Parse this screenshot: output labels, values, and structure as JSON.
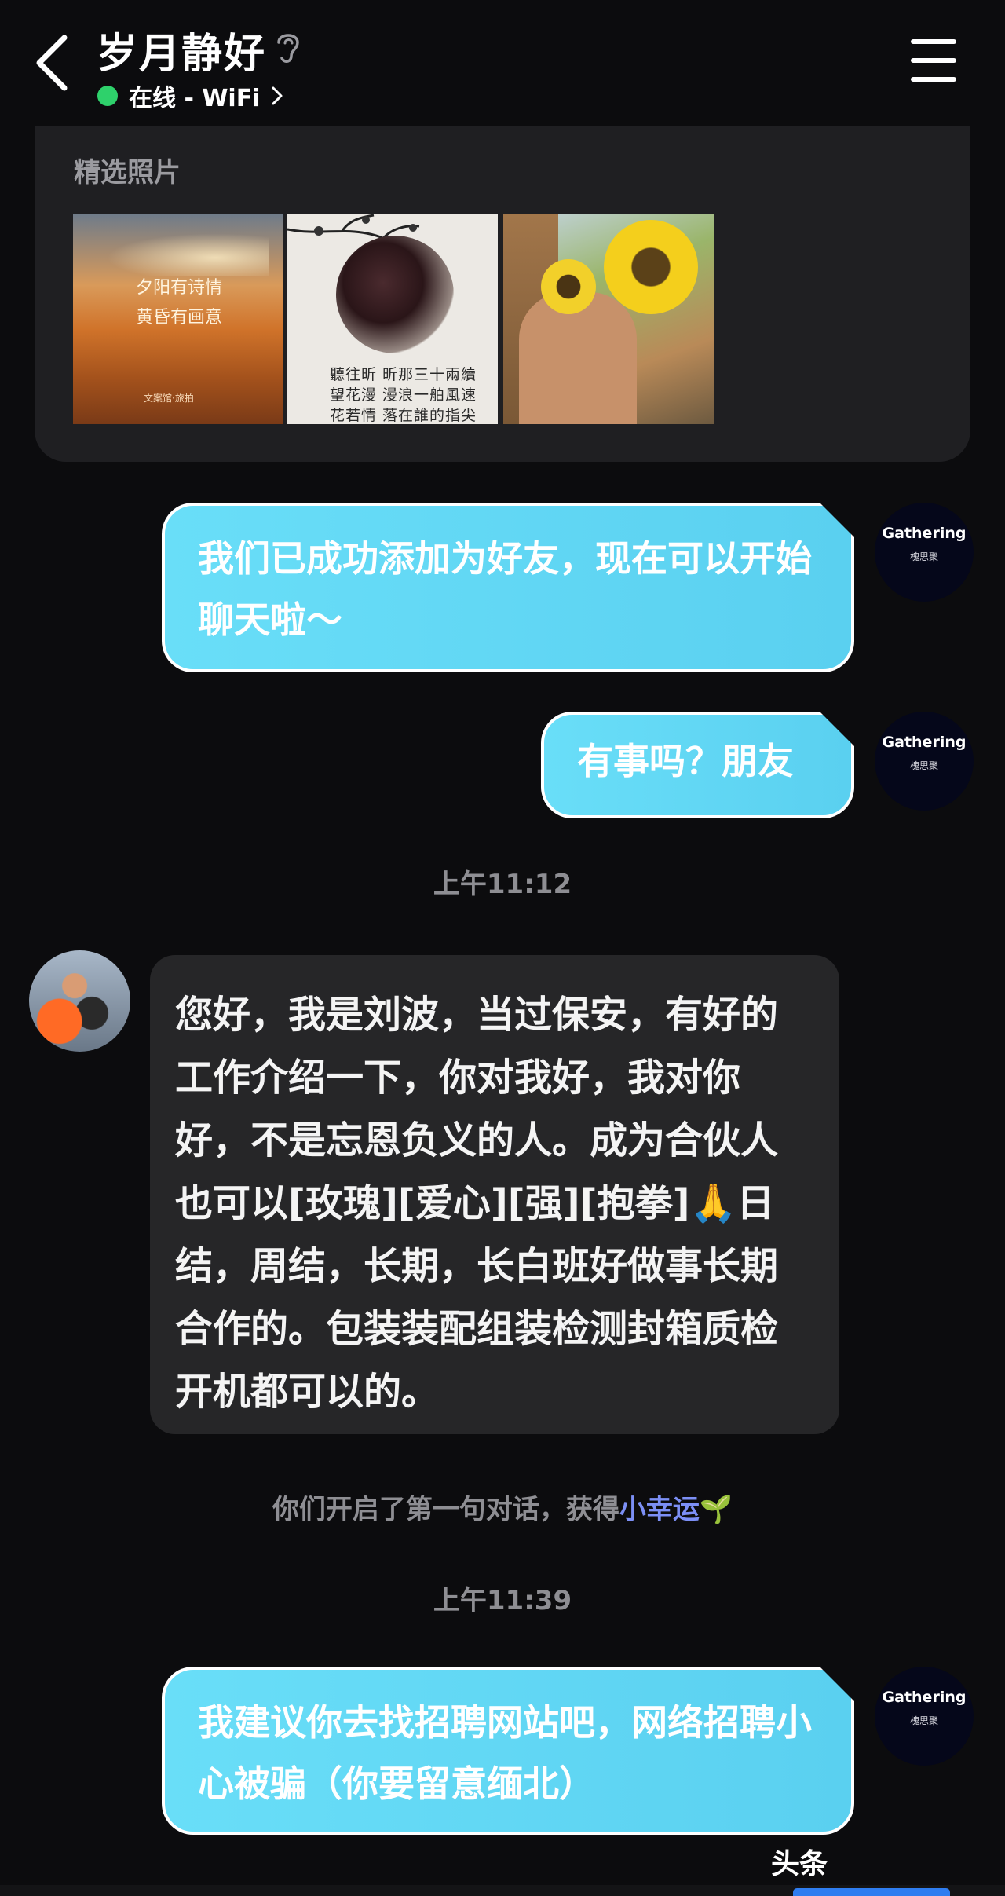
{
  "header": {
    "title": "岁月静好",
    "status_text": "在线 - WiFi",
    "status_color": "#2ed16b"
  },
  "photos": {
    "label": "精选照片",
    "items": [
      {
        "caption_line1": "夕阳有诗情",
        "caption_line2": "黄昏有画意",
        "footer": "文案馆·旅拍"
      },
      {
        "poem_line1": "聽往昕  昕那三十兩續",
        "poem_line2": "望花漫  漫浪一舶風速",
        "poem_line3": "花若情  落在誰的指尖"
      },
      {
        "alt": "sunflower-photo"
      }
    ]
  },
  "self_avatar": {
    "name": "Gathering",
    "subtitle": "槐思聚"
  },
  "messages": [
    {
      "direction": "out",
      "text": "我们已成功添加为好友，现在可以开始聊天啦～"
    },
    {
      "direction": "out",
      "text": "有事吗？朋友"
    },
    {
      "type": "timestamp",
      "text": "上午11:12"
    },
    {
      "direction": "in",
      "text": "您好，我是刘波，当过保安，有好的工作介绍一下，你对我好，我对你好，不是忘恩负义的人。成为合伙人也可以[玫瑰][爱心][强][抱拳]🙏日结，周结，长期，长白班好做事长期合作的。包装装配组装检测封箱质检开机都可以的。"
    },
    {
      "type": "system",
      "text": "你们开启了第一句对话，获得",
      "link": "小幸运",
      "emoji": "🌱"
    },
    {
      "type": "timestamp",
      "text": "上午11:39"
    },
    {
      "direction": "out",
      "text": "我建议你去找招聘网站吧，网络招聘小心被骗（你要留意缅北）"
    }
  ],
  "watermark": "头条 @Gathering",
  "colors": {
    "background": "#0c0c0e",
    "bubble_out": "#5fd6f4",
    "bubble_in": "#262628",
    "link": "#7c8ff5"
  }
}
